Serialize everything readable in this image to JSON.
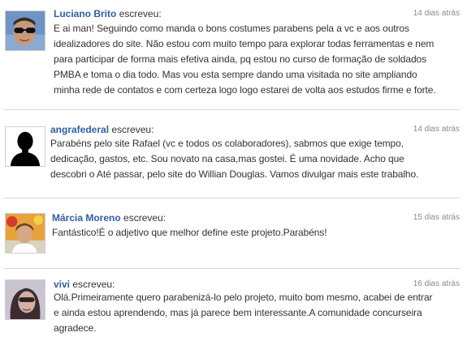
{
  "comments": [
    {
      "author": "Luciano Brito",
      "verb": "escreveu:",
      "time": "14 dias atrás",
      "lines": [
        "E ai man! Seguindo como manda o bons costumes parabens pela a vc e aos outros",
        "idealizadores do site. Não estou com muito tempo para explorar todas ferramentas e nem",
        "para participar de forma mais efetiva ainda, pq estou no curso de formação de soldados",
        "PMBA e toma o dia todo. Mas vou esta sempre dando uma visitada no site ampliando",
        "minha rede de contatos e com certeza logo logo estarei de volta aos estudos firme e forte."
      ]
    },
    {
      "author": "angrafederal",
      "verb": "escreveu:",
      "time": "14 dias atrás",
      "lines": [
        "Parabéns pelo site Rafael (vc e todos os colaboradores), sabmos que exige tempo,",
        "dedicação, gastos, etc. Sou novato na casa,mas gostei. É uma novidade. Acho que",
        "descobri o Até passar, pelo site do Willian Douglas. Vamos divulgar mais este trabalho."
      ]
    },
    {
      "author": "Márcia Moreno",
      "verb": "escreveu:",
      "time": "15 dias atrás",
      "lines": [
        "Fantástico!É o adjetivo que melhor define este projeto.Parabéns!"
      ]
    },
    {
      "author": "vivi",
      "verb": "escreveu:",
      "time": "16 dias atrás",
      "lines": [
        "Olá.Primeiramente quero parabenizá-lo pelo projeto, muito bom mesmo, acabei de entrar",
        "e ainda estou aprendendo, mas já parece bem interessante.A comunidade concurseira",
        "agradece."
      ]
    }
  ],
  "colors": {
    "author_link": "#2f5ea3",
    "time": "#8a8a8a",
    "divider": "#d8d8d8"
  }
}
